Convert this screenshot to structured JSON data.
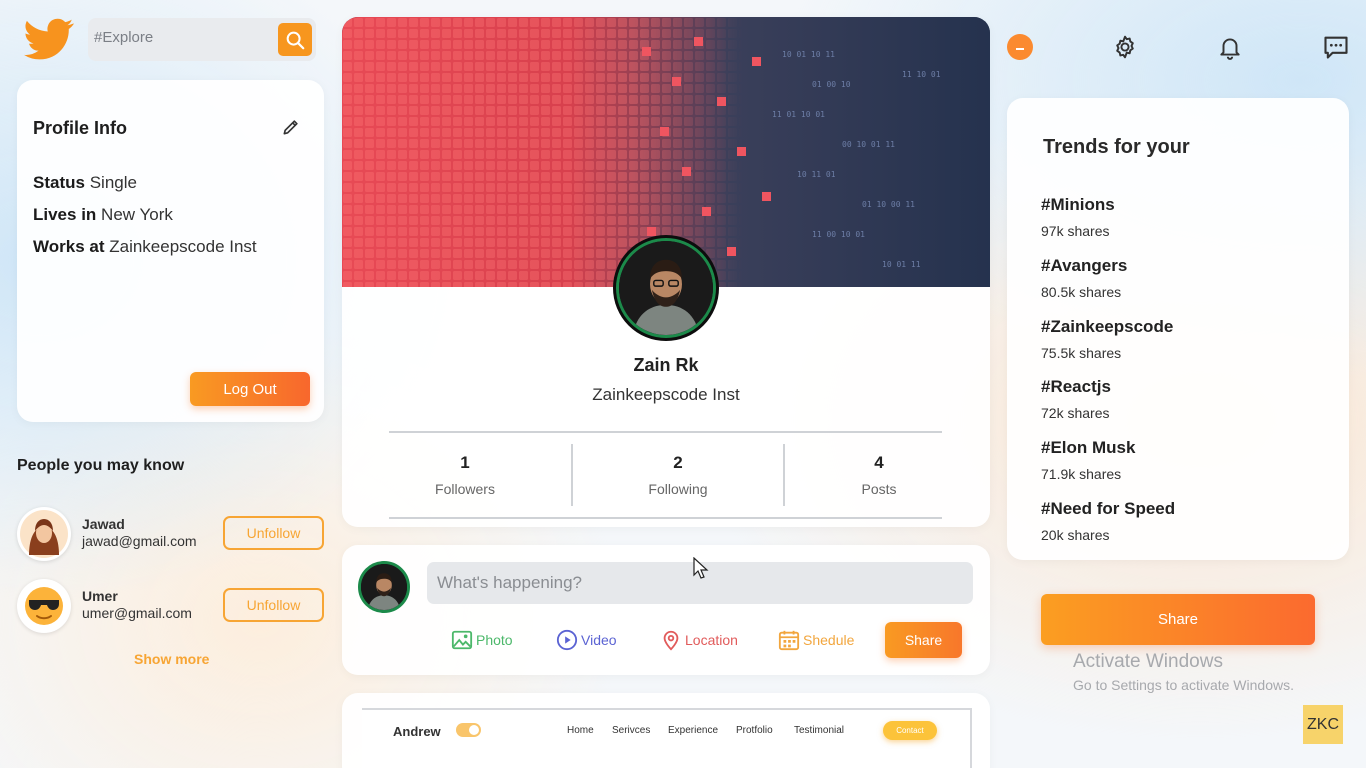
{
  "search": {
    "placeholder": "#Explore"
  },
  "profile": {
    "title": "Profile Info",
    "status_label": "Status",
    "status_value": "Single",
    "lives_label": "Lives in",
    "lives_value": "New York",
    "works_label": "Works at",
    "works_value": "Zainkeepscode Inst",
    "logout": "Log Out"
  },
  "people": {
    "title": "People you may know",
    "items": [
      {
        "name": "Jawad",
        "email": "jawad@gmail.com",
        "action": "Unfollow"
      },
      {
        "name": "Umer",
        "email": "umer@gmail.com",
        "action": "Unfollow"
      }
    ],
    "show_more": "Show more"
  },
  "user": {
    "name": "Zain Rk",
    "org": "Zainkeepscode Inst",
    "stats": [
      {
        "value": "1",
        "label": "Followers"
      },
      {
        "value": "2",
        "label": "Following"
      },
      {
        "value": "4",
        "label": "Posts"
      }
    ]
  },
  "post": {
    "placeholder": "What's happening?",
    "options": [
      {
        "label": "Photo",
        "icon": "photo-icon",
        "color": "#4cb86a"
      },
      {
        "label": "Video",
        "icon": "video-icon",
        "color": "#5b63d3"
      },
      {
        "label": "Location",
        "icon": "location-icon",
        "color": "#e15b5b"
      },
      {
        "label": "Shedule",
        "icon": "calendar-icon",
        "color": "#f2a63e"
      }
    ],
    "share": "Share"
  },
  "preview": {
    "name": "Andrew",
    "links": [
      "Home",
      "Serivces",
      "Experience",
      "Protfolio",
      "Testimonial"
    ],
    "contact": "Contact"
  },
  "trends": {
    "title": "Trends for your",
    "items": [
      {
        "tag": "#Minions",
        "shares": "97k shares"
      },
      {
        "tag": "#Avangers",
        "shares": "80.5k shares"
      },
      {
        "tag": "#Zainkeepscode",
        "shares": "75.5k shares"
      },
      {
        "tag": "#Reactjs",
        "shares": "72k shares"
      },
      {
        "tag": "#Elon Musk",
        "shares": "71.9k shares"
      },
      {
        "tag": "#Need for Speed",
        "shares": "20k shares"
      }
    ]
  },
  "share_button": "Share",
  "activation": {
    "title": "Activate Windows",
    "subtitle": "Go to Settings to activate Windows."
  },
  "watermark": "ZKC",
  "colors": {
    "accent": "#f8862a",
    "accent_light": "#f7a534"
  }
}
